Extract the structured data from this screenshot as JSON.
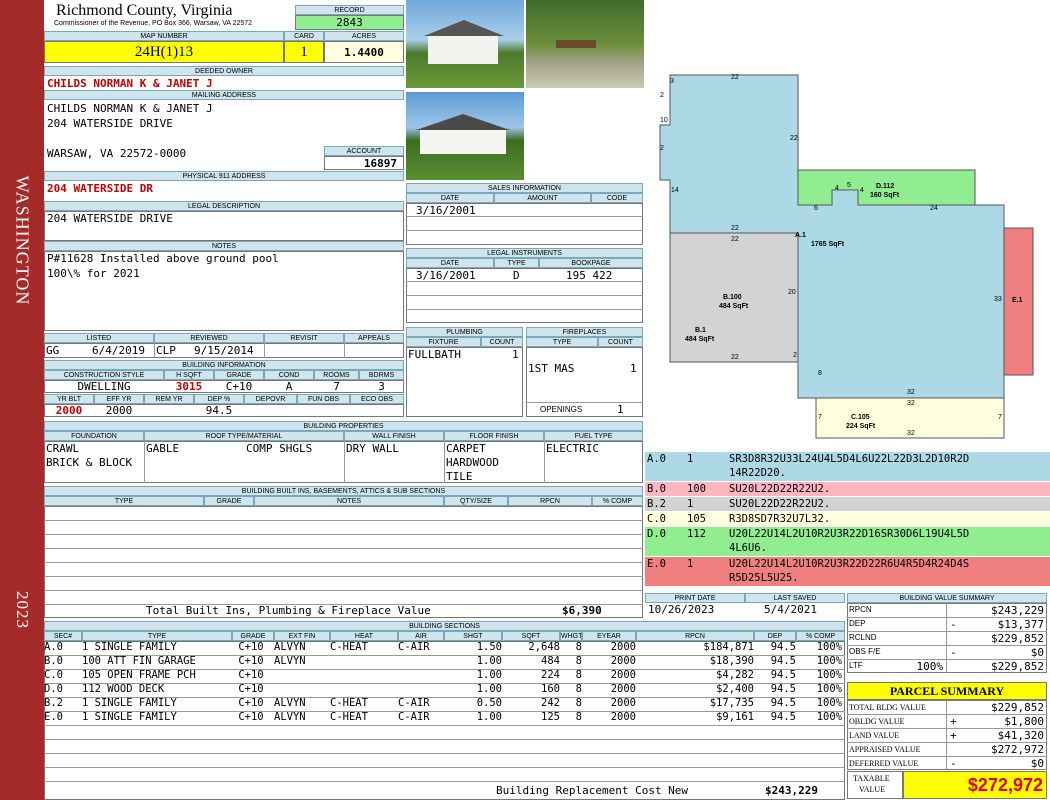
{
  "sidebar": {
    "district": "WASHINGTON",
    "year": "2023"
  },
  "header": {
    "county": "Richmond County, Virginia",
    "commissioner": "Commissioner of the Revenue, PO Box 366, Warsaw, VA 22572",
    "record_label": "RECORD",
    "record": "2843",
    "map_label": "MAP NUMBER",
    "map": "24H(1)13",
    "card_label": "CARD",
    "card": "1",
    "acres_label": "ACRES",
    "acres": "1.4400"
  },
  "owner": {
    "label": "DEEDED OWNER",
    "name": "CHILDS NORMAN K & JANET J"
  },
  "mailing": {
    "label": "MAILING ADDRESS",
    "line1": "CHILDS NORMAN K & JANET J",
    "line2": "204 WATERSIDE DRIVE",
    "line3": "WARSAW, VA 22572-0000",
    "account_label": "ACCOUNT",
    "account": "16897"
  },
  "physical": {
    "label": "PHYSICAL 911 ADDRESS",
    "address": "204 WATERSIDE DR"
  },
  "legal": {
    "label": "LEGAL DESCRIPTION",
    "text": "204 WATERSIDE DRIVE"
  },
  "notes": {
    "label": "NOTES",
    "line1": "P#11628 Installed above ground pool",
    "line2": "100\\% for 2021"
  },
  "review": {
    "listed_label": "LISTED",
    "reviewed_label": "REVIEWED",
    "revisit_label": "REVISIT",
    "appeals_label": "APPEALS",
    "listed_by": "GG",
    "listed_date": "6/4/2019",
    "reviewed_by": "CLP",
    "reviewed_date": "9/15/2014"
  },
  "building_info": {
    "label": "BUILDING INFORMATION",
    "h_style": "CONSTRUCTION STYLE",
    "h_hsqft": "H SQFT",
    "h_grade": "GRADE",
    "h_cond": "COND",
    "h_rooms": "ROOMS",
    "h_bdrms": "BDRMS",
    "style": "DWELLING",
    "hsqft": "3015",
    "grade": "C+10",
    "cond": "A",
    "rooms": "7",
    "bdrms": "3",
    "h_yrblt": "YR BLT",
    "h_effyr": "EFF YR",
    "h_remyr": "REM YR",
    "h_dep": "DEP %",
    "h_depovr": "DEPOVR",
    "h_funobs": "FUN OBS",
    "h_ecoobs": "ECO OBS",
    "yrblt": "2000",
    "effyr": "2000",
    "dep": "94.5"
  },
  "sales": {
    "label": "SALES INFORMATION",
    "h_date": "DATE",
    "h_amount": "AMOUNT",
    "h_code": "CODE",
    "date": "3/16/2001"
  },
  "legal_instruments": {
    "label": "LEGAL INSTRUMENTS",
    "h_date": "DATE",
    "h_type": "TYPE",
    "h_bookpage": "BOOKPAGE",
    "date": "3/16/2001",
    "type": "D",
    "bookpage": "195 422"
  },
  "plumbing": {
    "label": "PLUMBING",
    "h_fixture": "FIXTURE",
    "h_count": "COUNT",
    "fixture": "FULLBATH",
    "count": "1"
  },
  "fireplaces": {
    "label": "FIREPLACES",
    "h_type": "TYPE",
    "h_count": "COUNT",
    "type": "1ST MAS",
    "count": "1",
    "openings_label": "OPENINGS",
    "openings": "1"
  },
  "properties": {
    "label": "BUILDING PROPERTIES",
    "h_foundation": "FOUNDATION",
    "h_roof": "ROOF TYPE/MATERIAL",
    "h_wall": "WALL FINISH",
    "h_floor": "FLOOR FINISH",
    "h_fuel": "FUEL TYPE",
    "foundation1": "CRAWL",
    "foundation2": "BRICK & BLOCK",
    "roof_type": "GABLE",
    "roof_material": "COMP SHGLS",
    "wall": "DRY WALL",
    "floor1": "CARPET",
    "floor2": "HARDWOOD",
    "floor3": "TILE",
    "fuel": "ELECTRIC"
  },
  "builtins": {
    "label": "BUILDING BUILT INS, BASEMENTS, ATTICS & SUB SECTIONS",
    "h_type": "TYPE",
    "h_grade": "GRADE",
    "h_notes": "NOTES",
    "h_qty": "QTY/SIZE",
    "h_rpcn": "RPCN",
    "h_comp": "% COMP",
    "total_label": "Total Built Ins, Plumbing & Fireplace Value",
    "total": "$6,390"
  },
  "dates": {
    "print_label": "PRINT DATE",
    "print": "10/26/2023",
    "saved_label": "LAST SAVED",
    "saved": "5/4/2021"
  },
  "sections": {
    "label": "BUILDING SECTIONS",
    "headers": [
      "SEC#",
      "TYPE",
      "GRADE",
      "EXT FIN",
      "HEAT",
      "AIR",
      "SHGT",
      "SQFT",
      "WHGT",
      "EYEAR",
      "RPCN",
      "DEP",
      "% COMP"
    ],
    "rows": [
      [
        "A.0",
        "1 SINGLE FAMILY",
        "C+10",
        "ALVYN",
        "C-HEAT",
        "C-AIR",
        "1.50",
        "2,648",
        "8",
        "2000",
        "$184,871",
        "94.5",
        "100%"
      ],
      [
        "B.0",
        "100 ATT FIN GARAGE",
        "C+10",
        "ALVYN",
        "",
        "",
        "1.00",
        "484",
        "8",
        "2000",
        "$18,390",
        "94.5",
        "100%"
      ],
      [
        "C.0",
        "105 OPEN FRAME PCH",
        "C+10",
        "",
        "",
        "",
        "1.00",
        "224",
        "8",
        "2000",
        "$4,282",
        "94.5",
        "100%"
      ],
      [
        "D.0",
        "112 WOOD DECK",
        "C+10",
        "",
        "",
        "",
        "1.00",
        "160",
        "8",
        "2000",
        "$2,400",
        "94.5",
        "100%"
      ],
      [
        "B.2",
        "1 SINGLE FAMILY",
        "C+10",
        "ALVYN",
        "C-HEAT",
        "C-AIR",
        "0.50",
        "242",
        "8",
        "2000",
        "$17,735",
        "94.5",
        "100%"
      ],
      [
        "E.0",
        "1 SINGLE FAMILY",
        "C+10",
        "ALVYN",
        "C-HEAT",
        "C-AIR",
        "1.00",
        "125",
        "8",
        "2000",
        "$9,161",
        "94.5",
        "100%"
      ]
    ],
    "total_label": "Building Replacement Cost New",
    "total": "$243,229"
  },
  "value_summary": {
    "label": "BUILDING VALUE SUMMARY",
    "rpcn_label": "RPCN",
    "rpcn": "$243,229",
    "dep_label": "DEP",
    "dep_sign": "-",
    "dep": "$13,377",
    "rclnd_label": "RCLND",
    "rclnd": "$229,852",
    "obs_label": "OBS F/E",
    "obs_sign": "-",
    "obs": "$0",
    "ltf_label": "LTF",
    "ltf_pct": "100%",
    "ltf": "$229,852"
  },
  "parcel": {
    "title": "PARCEL SUMMARY",
    "bldg_label": "TOTAL BLDG VALUE",
    "bldg": "$229,852",
    "obldg_label": "OBLDG VALUE",
    "obldg_sign": "+",
    "obldg": "$1,800",
    "land_label": "LAND VALUE",
    "land_sign": "+",
    "land": "$41,320",
    "appraised_label": "APPRAISED VALUE",
    "appraised": "$272,972",
    "deferred_label": "DEFERRED VALUE",
    "deferred_sign": "-",
    "deferred": "$0",
    "taxable_label1": "TAXABLE",
    "taxable_label2": "VALUE",
    "taxable": "$272,972"
  },
  "sketch": {
    "A": {
      "name": "A.1",
      "area": "1765 SqFt"
    },
    "B": {
      "name": "B.100",
      "area": "484 SqFt"
    },
    "B2": {
      "name": "B.1",
      "area": "484 SqFt"
    },
    "C": {
      "name": "C.105",
      "area": "224 SqFt"
    },
    "D": {
      "name": "D.112",
      "area": "160 SqFt"
    },
    "E": {
      "name": "E.1"
    },
    "dims": {
      "d3": "3",
      "d22a": "22",
      "d2a": "2",
      "d10": "10",
      "d2b": "2",
      "d22b": "22",
      "d14": "14",
      "d6": "6",
      "d4a": "4",
      "d5": "5",
      "d4b": "4",
      "d24": "24",
      "d22c": "22",
      "d22d": "22",
      "d20": "20",
      "d33": "33",
      "d22e": "22",
      "d2c": "2",
      "d8": "8",
      "d32a": "32",
      "d32b": "32",
      "d7a": "7",
      "d7b": "7",
      "d32c": "32"
    },
    "legend": [
      {
        "code": "A.0",
        "num": "1",
        "text1": "SR3D8R32U33L24U4L5D4L6U22L22D3L2D10R2D",
        "text2": "14R22D20.",
        "color": "#add8e6"
      },
      {
        "code": "B.0",
        "num": "100",
        "text1": "SU20L22D22R22U2.",
        "text2": "",
        "color": "#ffb6c1"
      },
      {
        "code": "B.2",
        "num": "1",
        "text1": "SU20L22D22R22U2.",
        "text2": "",
        "color": "#d3d3d3"
      },
      {
        "code": "C.0",
        "num": "105",
        "text1": "R3D8SD7R32U7L32.",
        "text2": "",
        "color": "#ffffe0"
      },
      {
        "code": "D.0",
        "num": "112",
        "text1": "U20L22U14L2U10R2U3R22D16SR30D6L19U4L5D",
        "text2": "4L6U6.",
        "color": "#90ee90"
      },
      {
        "code": "E.0",
        "num": "1",
        "text1": "U20L22U14L2U10R2U3R22D22R6U4R5D4R24D4S",
        "text2": "R5D25L5U25.",
        "color": "#f08080"
      }
    ]
  }
}
